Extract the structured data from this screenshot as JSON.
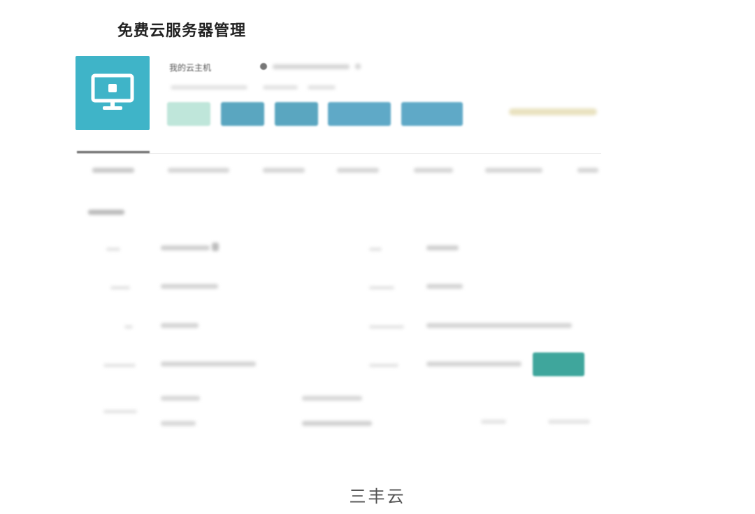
{
  "page": {
    "title": "免费云服务器管理",
    "caption": "三丰云"
  },
  "server": {
    "name": "我的云主机",
    "icon": "monitor-icon",
    "accent_color": "#3fb4c8"
  },
  "tabs": [
    {
      "label": ""
    },
    {
      "label": ""
    },
    {
      "label": ""
    },
    {
      "label": ""
    },
    {
      "label": ""
    },
    {
      "label": ""
    },
    {
      "label": ""
    }
  ],
  "details": {
    "section_title": ""
  },
  "colors": {
    "action_button": "#3fa69c",
    "primary_button": "#5aa6c0",
    "light_button": "#bfe6da"
  }
}
